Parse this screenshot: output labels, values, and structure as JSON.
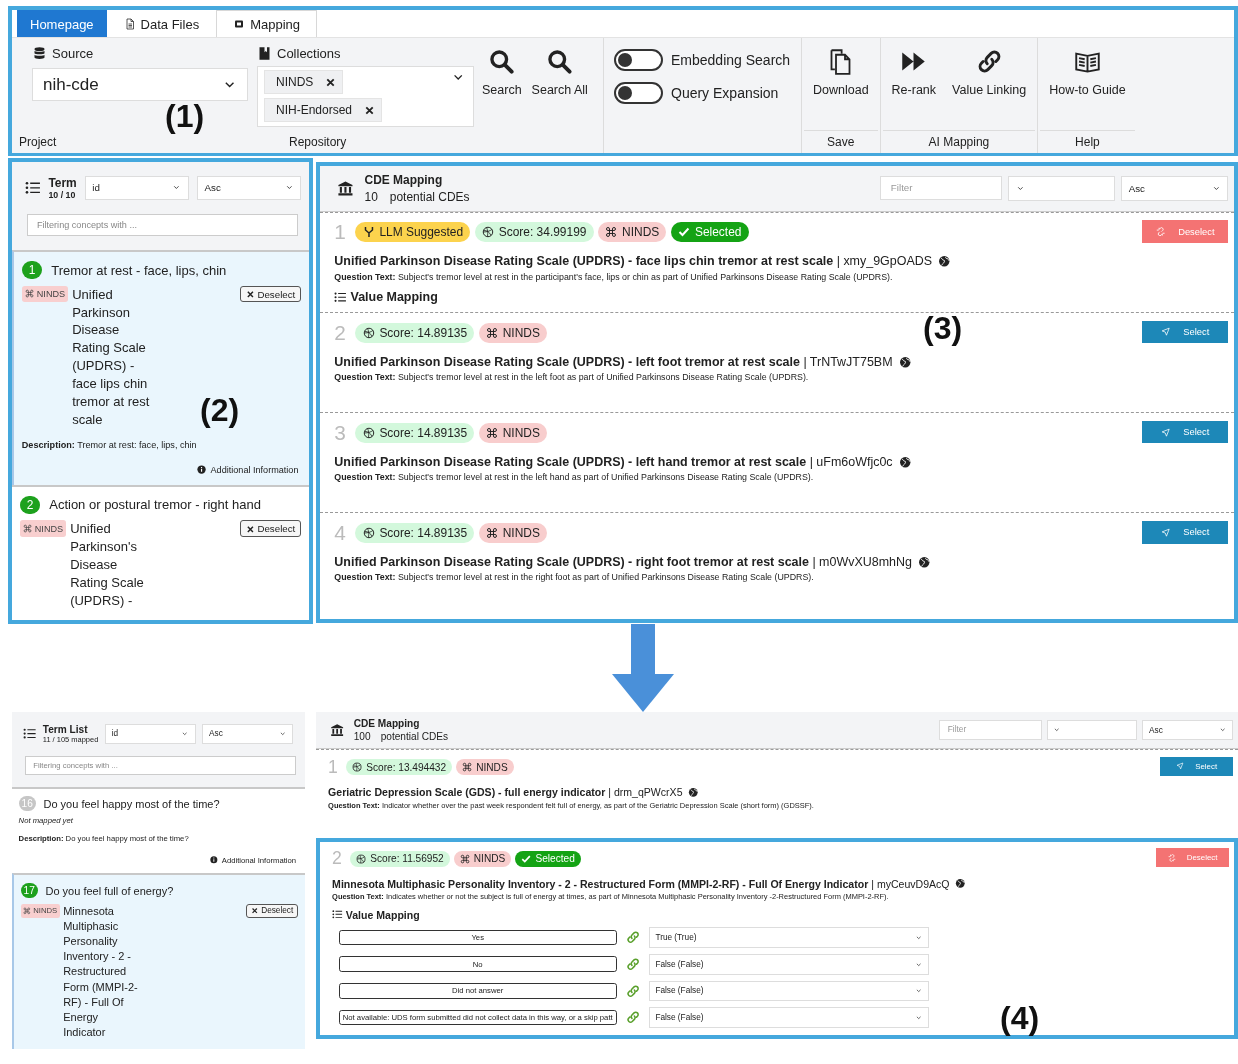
{
  "toolbar": {
    "annotation": "(1)",
    "tabs": [
      {
        "label": "Homepage",
        "kind": "home",
        "selected": false
      },
      {
        "label": "Data Files",
        "kind": "tab",
        "selected": false
      },
      {
        "label": "Mapping",
        "kind": "tab",
        "selected": true
      }
    ],
    "groups": [
      {
        "kind": "source",
        "label": "Project",
        "field_label": "Source",
        "value": "nih-cde"
      },
      {
        "kind": "collections",
        "label": "Repository",
        "field_label": "Collections",
        "chips": [
          "NINDS",
          "NIH-Endorsed"
        ],
        "buttons": [
          "Search",
          "Search All"
        ]
      },
      {
        "kind": "toggles",
        "toggles": [
          {
            "label": "Embedding Search",
            "on": false
          },
          {
            "label": "Query Expansion",
            "on": false
          }
        ]
      },
      {
        "kind": "buttons",
        "label": "Save",
        "buttons": [
          "Download"
        ]
      },
      {
        "kind": "buttons",
        "label": "AI Mapping",
        "buttons": [
          "Re-rank",
          "Value Linking"
        ]
      },
      {
        "kind": "buttons",
        "label": "Help",
        "buttons": [
          "How-to Guide"
        ]
      }
    ]
  },
  "before": {
    "term_list": {
      "annotation": "(2)",
      "title": "Term",
      "count": "10 / 10",
      "sort_field": "id",
      "sort_order": "Asc",
      "filter": {
        "placeholder": "Filtering concepts with ..."
      },
      "terms": [
        {
          "number": "1",
          "question": "Tremor at rest - face, lips, chin",
          "mapped": true,
          "selected": true,
          "repository": "NINDS",
          "cde": "Unified Parkinson Disease Rating Scale (UPDRS) - face lips chin tremor at rest scale",
          "button": "Deselect",
          "description": "**Description:** Tremor at rest: face, lips, chin",
          "info": "Additional Information"
        },
        {
          "number": "2",
          "question": "Action or postural tremor - right hand",
          "mapped": true,
          "selected": false,
          "repository": "NINDS",
          "cde": "Unified Parkinson's Disease Rating Scale (UPDRS) -",
          "button": "Deselect"
        }
      ]
    },
    "cde_mapping": {
      "annotation": "(3)",
      "title": "CDE Mapping",
      "count": "10",
      "count_label": "potential CDEs",
      "filter": {
        "placeholder": "Filter"
      },
      "sort_order": "Asc",
      "results": [
        {
          "rank": "1",
          "framed": false,
          "badges": [
            {
              "kind": "llm",
              "text": "LLM Suggested"
            },
            {
              "kind": "score",
              "text": "Score: 34.99199"
            },
            {
              "kind": "repo",
              "text": "NINDS"
            },
            {
              "kind": "selected",
              "text": "Selected"
            }
          ],
          "action": {
            "kind": "deselect",
            "label": "Deselect"
          },
          "title": "**Unified Parkinson Disease Rating Scale (UPDRS) - face lips chin tremor at rest scale** | xmy_9GpOADS",
          "question": "**Question Text:** Subject's tremor level at rest in the participant's face, lips or chin as part of Unified Parkinsons Disease Rating Scale (UPDRS).",
          "value_mapping": {
            "title": "Value Mapping"
          }
        },
        {
          "rank": "2",
          "framed": false,
          "badges": [
            {
              "kind": "score",
              "text": "Score: 14.89135"
            },
            {
              "kind": "repo",
              "text": "NINDS"
            }
          ],
          "action": {
            "kind": "select",
            "label": "Select"
          },
          "title": "**Unified Parkinson Disease Rating Scale (UPDRS) - left foot tremor at rest scale** | TrNTwJT75BM",
          "question": "**Question Text:** Subject's tremor level at rest in the left foot as part of Unified Parkinsons Disease Rating Scale (UPDRS)."
        },
        {
          "rank": "3",
          "framed": false,
          "badges": [
            {
              "kind": "score",
              "text": "Score: 14.89135"
            },
            {
              "kind": "repo",
              "text": "NINDS"
            }
          ],
          "action": {
            "kind": "select",
            "label": "Select"
          },
          "title": "**Unified Parkinson Disease Rating Scale (UPDRS) - left hand tremor at rest scale** | uFm6oWfjc0c",
          "question": "**Question Text:** Subject's tremor level at rest in the left hand as part of Unified Parkinsons Disease Rating Scale (UPDRS)."
        },
        {
          "rank": "4",
          "framed": false,
          "badges": [
            {
              "kind": "score",
              "text": "Score: 14.89135"
            },
            {
              "kind": "repo",
              "text": "NINDS"
            }
          ],
          "action": {
            "kind": "select",
            "label": "Select"
          },
          "title": "**Unified Parkinson Disease Rating Scale (UPDRS) - right foot tremor at rest scale** | m0WvXU8mhNg",
          "question": "**Question Text:** Subject's tremor level at rest in the right foot as part of Unified Parkinsons Disease Rating Scale (UPDRS)."
        }
      ]
    }
  },
  "after": {
    "term_list": {
      "title": "Term List",
      "count": "11 / 105 mapped",
      "sort_field": "id",
      "sort_order": "Asc",
      "filter": {
        "placeholder": "Filtering concepts with ..."
      },
      "terms": [
        {
          "number": "16",
          "question": "Do you feel happy most of the time?",
          "mapped": false,
          "selected": false,
          "status": "Not mapped yet",
          "description": "**Description:** Do you feel happy most of the time?",
          "info": "Additional Information"
        },
        {
          "number": "17",
          "question": "Do you feel full of energy?",
          "mapped": true,
          "selected": true,
          "repository": "NINDS",
          "cde": "Minnesota Multiphasic Personality Inventory - 2 - Restructured Form (MMPI-2-RF) - Full Of Energy Indicator",
          "button": "Deselect"
        }
      ]
    },
    "cde_mapping": {
      "title": "CDE Mapping",
      "count": "100",
      "count_label": "potential CDEs",
      "filter": {
        "placeholder": "Filter"
      },
      "sort_order": "Asc",
      "results": [
        {
          "rank": "1",
          "framed": false,
          "badges": [
            {
              "kind": "score",
              "text": "Score: 13.494432"
            },
            {
              "kind": "repo",
              "text": "NINDS"
            }
          ],
          "action": {
            "kind": "select",
            "label": "Select"
          },
          "title": "**Geriatric Depression Scale (GDS) - full energy indicator** | drm_qPWcrX5",
          "question": "**Question Text:** Indicator whether over the past week respondent felt full of energy, as part of the Geriatric Depression Scale (short form) (GDSSF)."
        },
        {
          "rank": "2",
          "framed": true,
          "annotation": "(4)",
          "badges": [
            {
              "kind": "score",
              "text": "Score: 11.56952"
            },
            {
              "kind": "repo",
              "text": "NINDS"
            },
            {
              "kind": "selected",
              "text": "Selected"
            }
          ],
          "action": {
            "kind": "deselect",
            "label": "Deselect"
          },
          "title": "**Minnesota Multiphasic Personality Inventory - 2 - Restructured Form (MMPI-2-RF) - Full Of Energy Indicator** | myCeuvD9AcQ",
          "question": "**Question Text:** Indicates whether or not the subject is full of energy at times, as part of Minnesota Multiphasic Personality Inventory -2-Restructured Form (MMPI-2-RF).",
          "value_mapping": {
            "title": "Value Mapping",
            "rows": [
              {
                "source": "Yes",
                "target": "True (True)"
              },
              {
                "source": "No",
                "target": "False (False)"
              },
              {
                "source": "Did not answer",
                "target": "False (False)"
              },
              {
                "source": "Not available: UDS form submitted did not collect data in this way, or a skip patt",
                "target": "False (False)"
              }
            ]
          }
        }
      ]
    }
  }
}
